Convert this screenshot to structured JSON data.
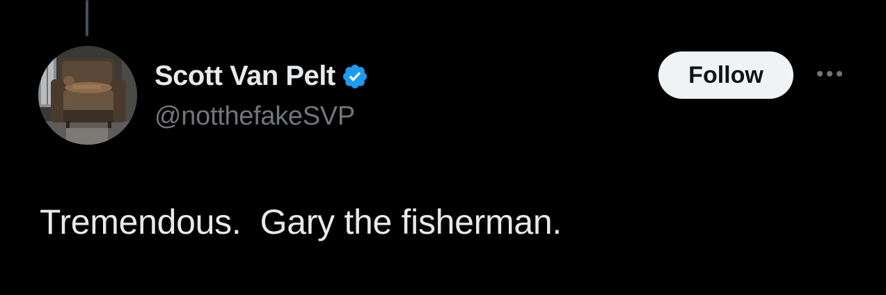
{
  "author": {
    "display_name": "Scott Van Pelt",
    "handle": "@notthefakeSVP",
    "verified": true,
    "verified_icon": "verified-badge-icon",
    "avatar_icon": "avatar-photo"
  },
  "actions": {
    "follow_label": "Follow",
    "more_icon": "more-options-icon"
  },
  "tweet": {
    "text": "Tremendous.  Gary the fisherman."
  },
  "colors": {
    "background": "#000000",
    "primary_text": "#e7e9ea",
    "secondary_text": "#71767b",
    "verified_blue": "#1d9bf0",
    "follow_button_bg": "#eff3f4",
    "follow_button_text": "#0f1419"
  }
}
